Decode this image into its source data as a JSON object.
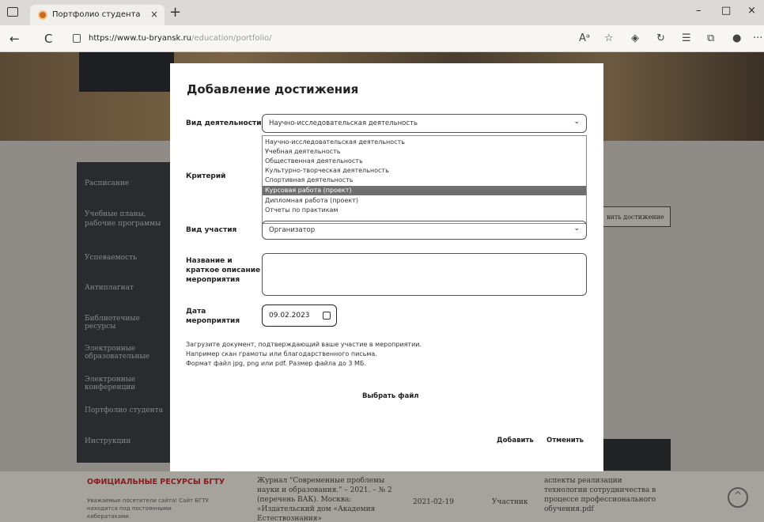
{
  "browser": {
    "tab_title": "Портфолио студента",
    "tab_close": "×",
    "new_tab": "+",
    "url_main": "https://www.tu-bryansk.ru",
    "url_path": "/education/portfolio/",
    "win_min": "–",
    "win_max": "□",
    "win_close": "×",
    "nav_back": "←",
    "nav_reload": "C",
    "toolbar_more": "···"
  },
  "page": {
    "sidebar": [
      "Расписание",
      "Учебные планы, рабочие программы дисциплин, программы практик",
      "Успеваемость",
      "Антиплагиат",
      "Библиотечные ресурсы",
      "Электронные образовательные",
      "Электронные конференции",
      "Портфолио студента",
      "Инструкции"
    ],
    "add_achievement_button": "вить достижение",
    "footer": {
      "title": "ОФИЦИАЛЬНЫЕ РЕСУРСЫ БГТУ",
      "subtitle": "Уважаемые посетители сайта! Сайт БГТУ находится под постоянными кибератаками.",
      "journal": "Журнал \"Современные проблемы науки и образования.\" – 2021. – № 2 (перечень ВАК). Москва: «Издательский дом «Академия Естествознания»",
      "date": "2021-02-19",
      "role": "Участник",
      "aspect": "аспекты реализации технологии сотрудничества в процессе профессионального обучения.pdf"
    },
    "scroll_top": "^"
  },
  "modal": {
    "title": "Добавление достижения",
    "activity_label": "Вид деятельности",
    "activity_value": "Научно-исследовательская деятельность",
    "criterion_label": "Критерий",
    "dropdown_options": [
      "Научно-исследовательская деятельность",
      "Учебная деятельность",
      "Общественная деятельность",
      "Культурно-творческая деятельность",
      "Спортивная деятельность",
      "Курсовая работа (проект)",
      "Дипломная работа (проект)",
      "Отчеты по практикам"
    ],
    "selected_option_index": 5,
    "participation_label": "Вид участия",
    "participation_value": "Организатор",
    "event_label_1": "Название и",
    "event_label_2": "краткое описание",
    "event_label_3": "мероприятия",
    "date_label_1": "Дата",
    "date_label_2": "мероприятия",
    "date_value": "09.02.2023",
    "hint_line1": "Загрузите документ, подтверждающий ваше участие в мероприятии.",
    "hint_line2": "Например скан грамоты или благодарственного письма.",
    "hint_line3": "Формат файл jpg, png или pdf. Размер файла до 3 МБ.",
    "choose_file": "Выбрать файл",
    "add_button": "Добавить",
    "cancel_button": "Отменить"
  }
}
